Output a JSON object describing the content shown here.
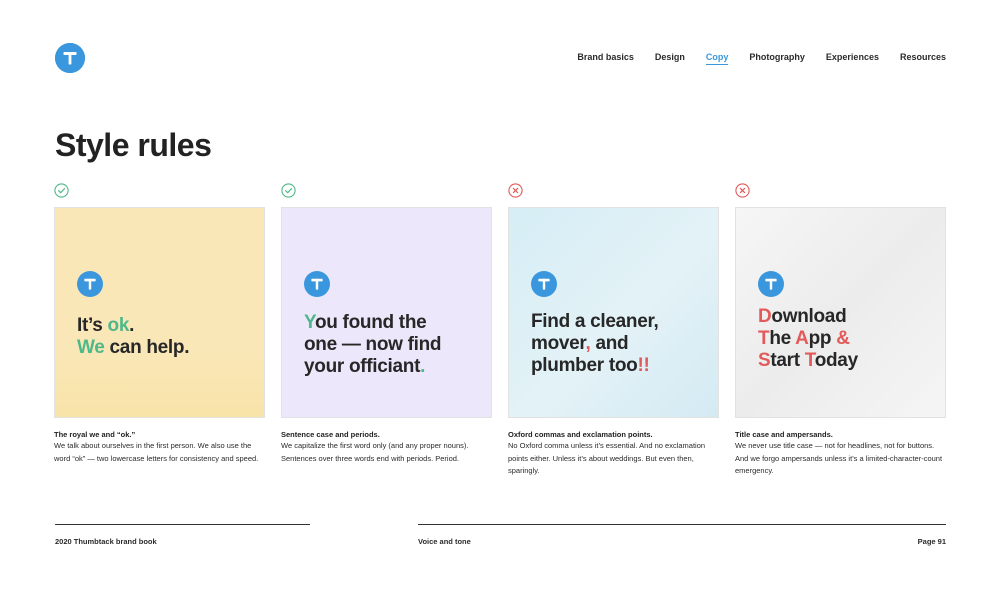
{
  "nav": {
    "items": [
      {
        "label": "Brand basics",
        "active": false
      },
      {
        "label": "Design",
        "active": false
      },
      {
        "label": "Copy",
        "active": true
      },
      {
        "label": "Photography",
        "active": false
      },
      {
        "label": "Experiences",
        "active": false
      },
      {
        "label": "Resources",
        "active": false
      }
    ]
  },
  "page": {
    "title": "Style rules"
  },
  "colors": {
    "brand_blue": "#3b97dd",
    "green": "#4fb88a",
    "red": "#e25a5a"
  },
  "cards": [
    {
      "status": "check-icon",
      "headline": [
        [
          {
            "t": "It’s "
          },
          {
            "t": "ok",
            "c": "g"
          },
          {
            "t": "."
          }
        ],
        [
          {
            "t": "We",
            "c": "g"
          },
          {
            "t": " can help."
          }
        ]
      ],
      "caption_title": "The royal we and “ok.”",
      "caption_body": "We talk about ourselves in the first person. We also use the word “ok” — two lowercase letters for consistency and speed."
    },
    {
      "status": "check-icon",
      "headline": [
        [
          {
            "t": "Y",
            "c": "g"
          },
          {
            "t": "ou found the"
          }
        ],
        [
          {
            "t": "one — now find"
          }
        ],
        [
          {
            "t": "your officiant"
          },
          {
            "t": ".",
            "c": "g"
          }
        ]
      ],
      "caption_title": "Sentence case and periods.",
      "caption_body": "We capitalize the first word only (and any proper nouns). Sentences over three words end with periods. Period."
    },
    {
      "status": "cross-icon",
      "headline": [
        [
          {
            "t": "Find a cleaner,"
          }
        ],
        [
          {
            "t": "mover"
          },
          {
            "t": ",",
            "c": "r"
          },
          {
            "t": " and"
          }
        ],
        [
          {
            "t": "plumber too"
          },
          {
            "t": "!!",
            "c": "r"
          }
        ]
      ],
      "caption_title": "Oxford commas and exclamation points.",
      "caption_body": "No Oxford comma unless it’s essential. And no exclamation points either. Unless it’s about weddings. But even then, sparingly."
    },
    {
      "status": "cross-icon",
      "headline": [
        [
          {
            "t": "D",
            "c": "r"
          },
          {
            "t": "ownload"
          }
        ],
        [
          {
            "t": "T",
            "c": "r"
          },
          {
            "t": "he "
          },
          {
            "t": "A",
            "c": "r"
          },
          {
            "t": "pp "
          },
          {
            "t": "&",
            "c": "r"
          }
        ],
        [
          {
            "t": "S",
            "c": "r"
          },
          {
            "t": "tart "
          },
          {
            "t": "T",
            "c": "r"
          },
          {
            "t": "oday"
          }
        ]
      ],
      "caption_title": "Title case and ampersands.",
      "caption_body": "We never use title case — not for headlines, not for buttons. And we forgo ampersands unless it’s a limited-character-count emergency."
    }
  ],
  "footer": {
    "left": "2020 Thumbtack brand book",
    "center": "Voice and tone",
    "right": "Page 91"
  }
}
